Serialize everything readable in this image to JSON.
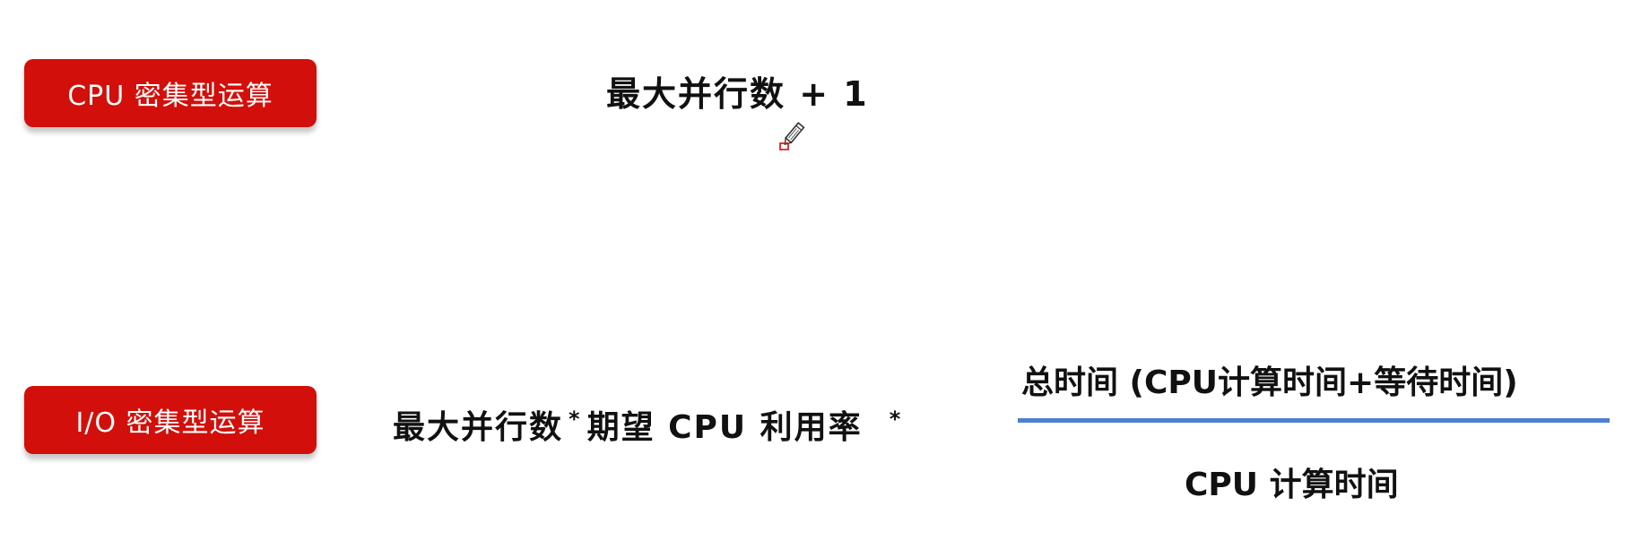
{
  "rows": [
    {
      "tag_label": "CPU 密集型运算",
      "formula": "最大并行数 + 1"
    },
    {
      "tag_label": "I/O 密集型运算",
      "formula_part1": "最大并行数",
      "operator1": "*",
      "formula_part2": "期望 CPU 利用率",
      "operator2": "*",
      "fraction": {
        "numerator": "总时间 (CPU计算时间+等待时间)",
        "denominator": "CPU 计算时间"
      }
    }
  ],
  "colors": {
    "tag_background": "#d20f0a",
    "fraction_bar": "#4f7fd0",
    "cursor_accent": "#d20f0a"
  },
  "icons": {
    "cursor": "pencil-cursor-icon"
  }
}
